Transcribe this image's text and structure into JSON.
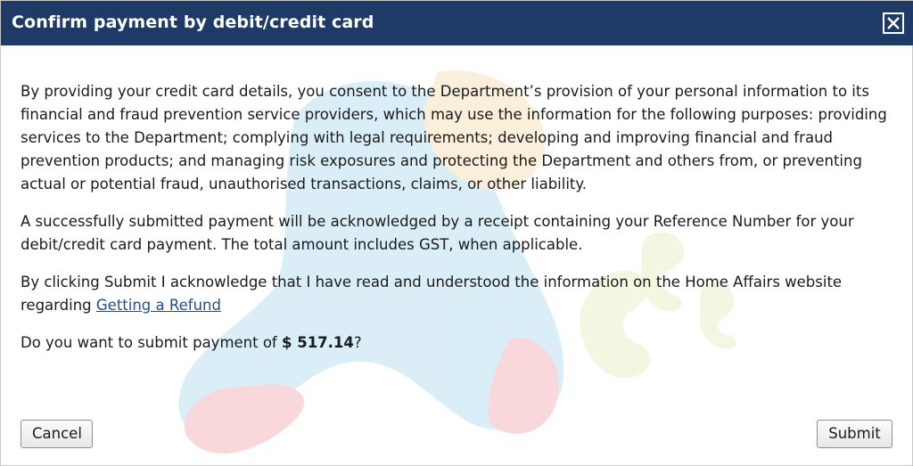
{
  "dialog": {
    "title": "Confirm payment by debit/credit card",
    "close_icon": "close-icon"
  },
  "body": {
    "paragraph_1": "By providing your credit card details, you consent to the Department’s provision of your personal information to its financial and fraud prevention service providers, which may use the information for the following purposes: providing services to the Department; complying with legal requirements; developing and improving financial and fraud prevention products; and managing risk exposures and protecting the Department and others from, or preventing actual or potential fraud, unauthorised transactions, claims, or other liability.",
    "paragraph_2": "A successfully submitted payment will be acknowledged by a receipt containing your Reference Number for your debit/credit card payment. The total amount includes GST, when applicable.",
    "paragraph_3_text": "By clicking Submit I acknowledge that I have read and understood the information on the Home Affairs website regarding ",
    "refund_link": "Getting a Refund",
    "question_prefix": "Do you want to submit payment of ",
    "amount": "$ 517.14",
    "question_suffix": "?"
  },
  "buttons": {
    "cancel": "Cancel",
    "submit": "Submit"
  },
  "colors": {
    "titlebar": "#1e3a66",
    "link": "#1f4e8c"
  }
}
